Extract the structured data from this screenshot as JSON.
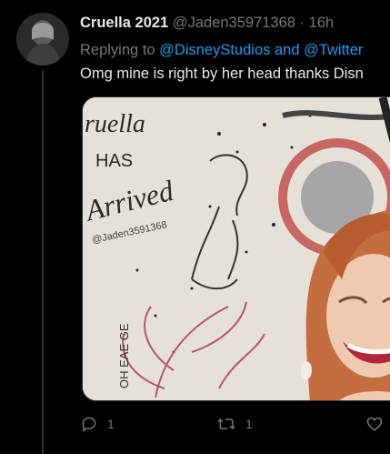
{
  "tweet": {
    "display_name": "Cruella 2021",
    "handle": "@Jaden35971368",
    "separator": "·",
    "time": "16h",
    "replying_prefix": "Replying to",
    "replying_to": "@DisneyStudios and @Twitter",
    "text": "Omg mine is right by her head  thanks Disn",
    "media": {
      "poster_text_line1": "ruella",
      "poster_text_line2": "HAS",
      "poster_text_line3": "Arrived",
      "poster_signature": "@Jaden3591368",
      "poster_vertical_text": "OH EAE GE"
    }
  },
  "actions": {
    "reply_count": "1",
    "retweet_count": "1",
    "like_count": ""
  },
  "colors": {
    "background": "#000000",
    "text_primary": "#e7e9ea",
    "text_secondary": "#71767b",
    "link": "#1d9bf0"
  },
  "icons": {
    "reply": "reply-icon",
    "retweet": "retweet-icon",
    "like": "heart-icon"
  }
}
